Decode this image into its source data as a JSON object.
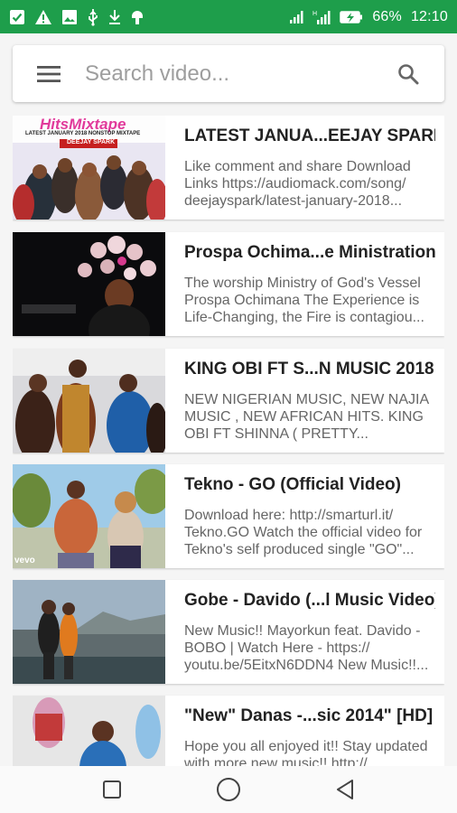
{
  "status_bar": {
    "battery": "66%",
    "time": "12:10",
    "left_icons": [
      "check-icon",
      "warning-icon",
      "image-icon",
      "usb-icon",
      "download-icon",
      "android-icon"
    ],
    "right_icons": [
      "signal-icon",
      "signal-h-icon",
      "signal-icon",
      "battery-charging-icon"
    ]
  },
  "search": {
    "placeholder": "Search video...",
    "value": ""
  },
  "videos": [
    {
      "title": "LATEST JANUA...EEJAY SPARK",
      "description": "Like comment and share Download Links https://audiomack.com/song/ deejayspark/latest-january-2018...",
      "thumb_label": "HitsMixtape",
      "thumb_sub": "LATEST JANUARY 2018 NONSTOP MIXTAPE",
      "thumb_tag": "DEEJAY SPARK"
    },
    {
      "title": "Prospa Ochima...e Ministration)",
      "description": "The worship Ministry of God's Vessel Prospa Ochimana The Experience is Life-Changing, the Fire is contagiou..."
    },
    {
      "title": "KING OBI FT S...N MUSIC 2018",
      "description": "NEW NIGERIAN MUSIC, NEW NAJIA MUSIC , NEW AFRICAN HITS. KING OBI FT SHINNA ( PRETTY..."
    },
    {
      "title": "Tekno - GO (Official Video)",
      "description": "Download here: http://smarturl.it/ Tekno.GO Watch the official video for Tekno's self produced single \"GO\"...",
      "thumb_watermark": "vevo"
    },
    {
      "title": "Gobe - Davido (...l Music Video)",
      "description": "New Music!! Mayorkun feat. Davido - BOBO | Watch Here - https:// youtu.be/5EitxN6DDN4 New Music!!..."
    },
    {
      "title": "\"New\" Danas -...sic 2014\" [HD]",
      "description": "Hope you all enjoyed it!! Stay updated with more new music!! http://..."
    }
  ],
  "nav": {
    "recent_icon": "square-icon",
    "home_icon": "circle-icon",
    "back_icon": "triangle-back-icon"
  },
  "colors": {
    "status_bar": "#1e9e4b",
    "background": "#f5f5f5"
  }
}
